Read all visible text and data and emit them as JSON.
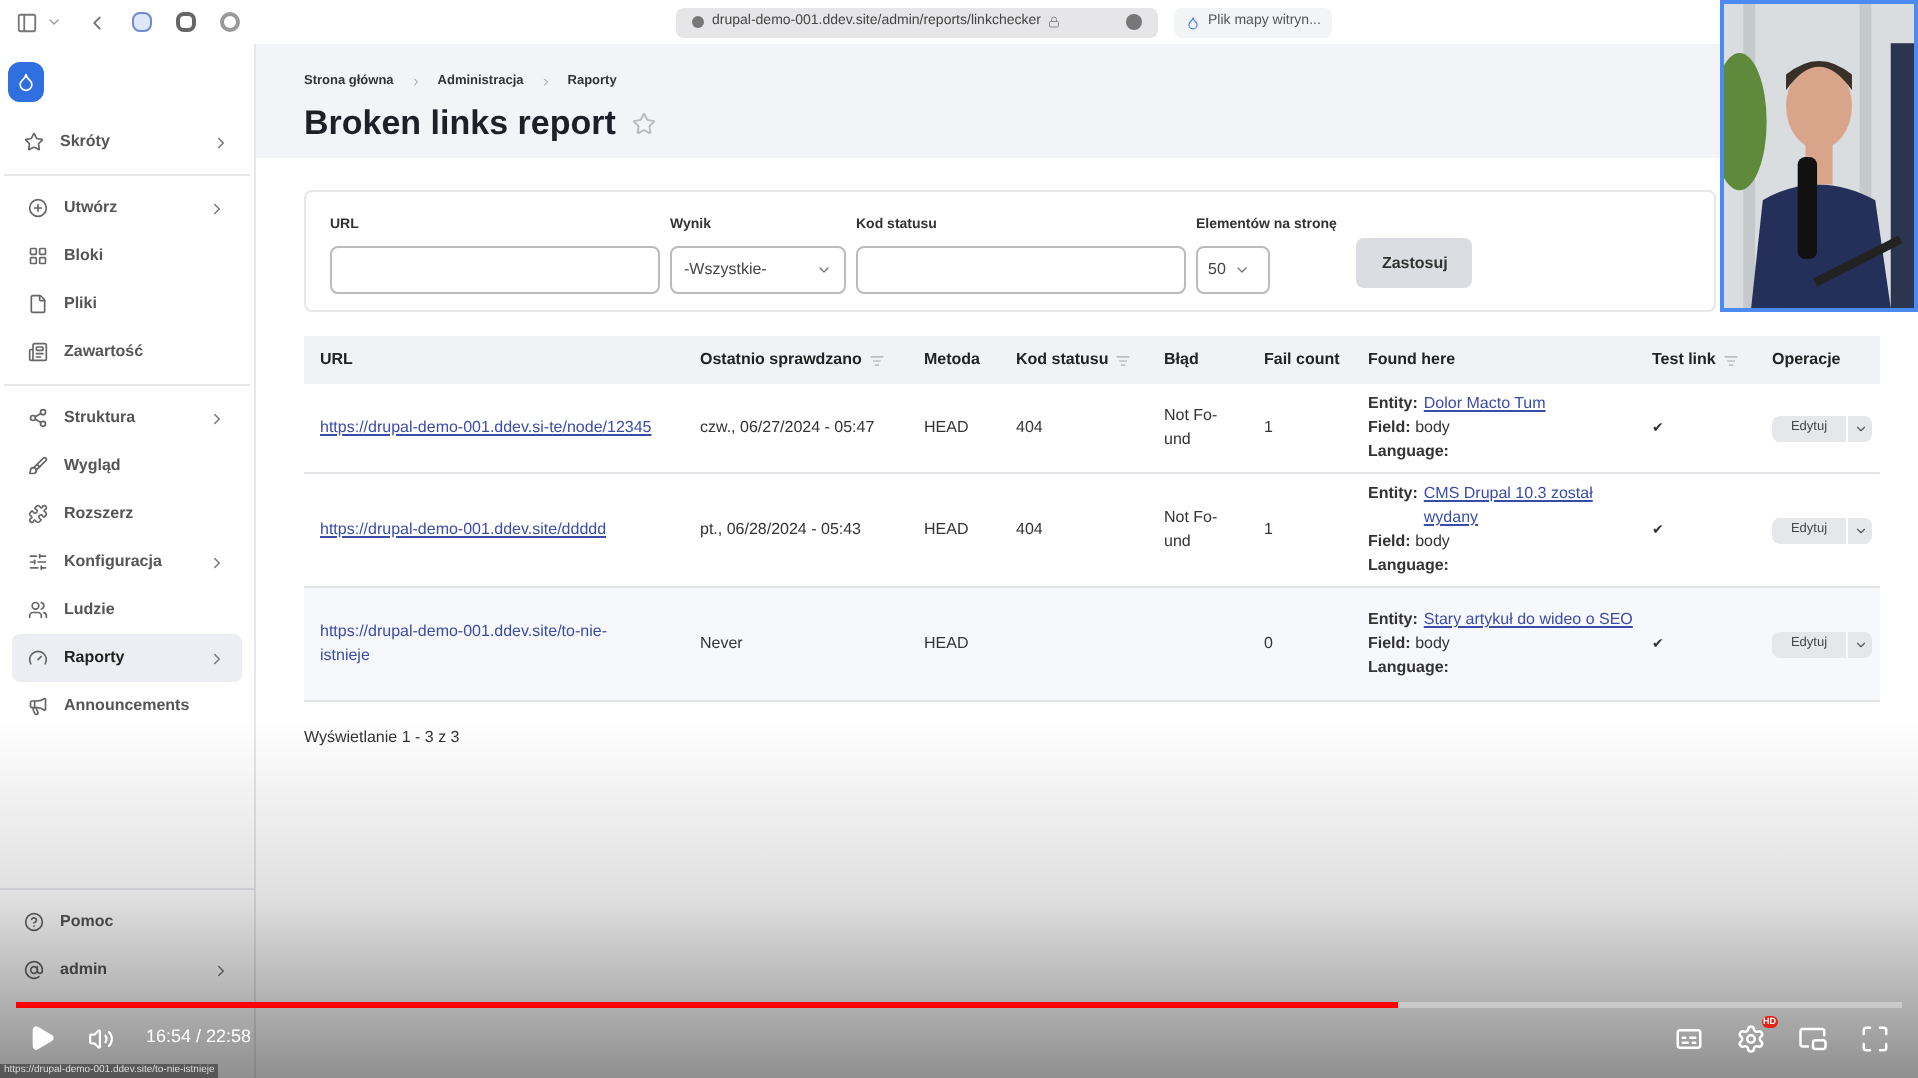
{
  "browser": {
    "address": "drupal-demo-001.ddev.site/admin/reports/linkchecker",
    "tab": "Plik mapy witryn..."
  },
  "sidebar": {
    "groups": [
      [
        {
          "label": "Skróty",
          "has_children": true,
          "selected": false
        }
      ],
      [
        {
          "label": "Utwórz",
          "has_children": true,
          "selected": false
        },
        {
          "label": "Bloki",
          "has_children": false,
          "selected": false
        },
        {
          "label": "Pliki",
          "has_children": false,
          "selected": false
        },
        {
          "label": "Zawartość",
          "has_children": false,
          "selected": false
        }
      ],
      [
        {
          "label": "Struktura",
          "has_children": true,
          "selected": false
        },
        {
          "label": "Wygląd",
          "has_children": false,
          "selected": false
        },
        {
          "label": "Rozszerz",
          "has_children": false,
          "selected": false
        },
        {
          "label": "Konfiguracja",
          "has_children": true,
          "selected": false
        },
        {
          "label": "Ludzie",
          "has_children": false,
          "selected": false
        },
        {
          "label": "Raporty",
          "has_children": true,
          "selected": true
        },
        {
          "label": "Announcements",
          "has_children": false,
          "selected": false
        }
      ]
    ],
    "footer": [
      {
        "label": "Pomoc",
        "has_children": false,
        "selected": false
      },
      {
        "label": "admin",
        "has_children": true,
        "selected": false
      }
    ]
  },
  "breadcrumb": [
    "Strona główna",
    "Administracja",
    "Raporty"
  ],
  "title": "Broken links report",
  "filters": {
    "url_label": "URL",
    "result_label": "Wynik",
    "result_value": "-Wszystkie-",
    "status_label": "Kod statusu",
    "per_page_label": "Elementów na stronę",
    "per_page_value": "50",
    "apply": "Zastosuj"
  },
  "table": {
    "columns": [
      {
        "label": "URL",
        "sortable": false
      },
      {
        "label": "Ostatnio sprawdzano",
        "sortable": true
      },
      {
        "label": "Metoda",
        "sortable": false
      },
      {
        "label": "Kod statusu",
        "sortable": true
      },
      {
        "label": "Błąd",
        "sortable": false
      },
      {
        "label": "Fail count",
        "sortable": false
      },
      {
        "label": "Found here",
        "sortable": false
      },
      {
        "label": "Test link",
        "sortable": true
      },
      {
        "label": "Operacje",
        "sortable": false
      }
    ],
    "rows": [
      {
        "url": "https://drupal-demo-001.ddev.si-te/node/12345",
        "checked": "czw., 06/27/2024 - 05:47",
        "method": "HEAD",
        "status": "404",
        "error": "Not Fo-und",
        "fail_count": "1",
        "entity_label": "Entity:",
        "entity": "Dolor Macto Tum",
        "field": "**Field:** body",
        "language": "Language:",
        "test_link": "✔",
        "edit": "Edytuj"
      },
      {
        "url": "https://drupal-demo-001.ddev.site/ddddd",
        "checked": "pt., 06/28/2024 - 05:43",
        "method": "HEAD",
        "status": "404",
        "error": "Not Fo-und",
        "fail_count": "1",
        "entity_label": "Entity:",
        "entity": "CMS Drupal 10.3 został wydany",
        "field": "**Field:** body",
        "language": "Language:",
        "test_link": "✔",
        "edit": "Edytuj"
      },
      {
        "url": "https://drupal-demo-001.ddev.site/to-nie-istnieje",
        "checked": "Never",
        "method": "HEAD",
        "status": "",
        "error": "",
        "fail_count": "0",
        "entity_label": "Entity:",
        "entity": "Stary artykuł do wideo o SEO",
        "field": "**Field:** body",
        "language": "Language:",
        "test_link": "✔",
        "edit": "Edytuj"
      }
    ]
  },
  "summary": "Wyświetlanie 1 - 3 z 3",
  "webcam": {
    "kind": "picture"
  },
  "player": {
    "level": 0.733,
    "time": "16:54 / 22:58",
    "badge": "HD",
    "status_url": "https://drupal-demo-001.ddev.site/to-nie-istnieje"
  }
}
